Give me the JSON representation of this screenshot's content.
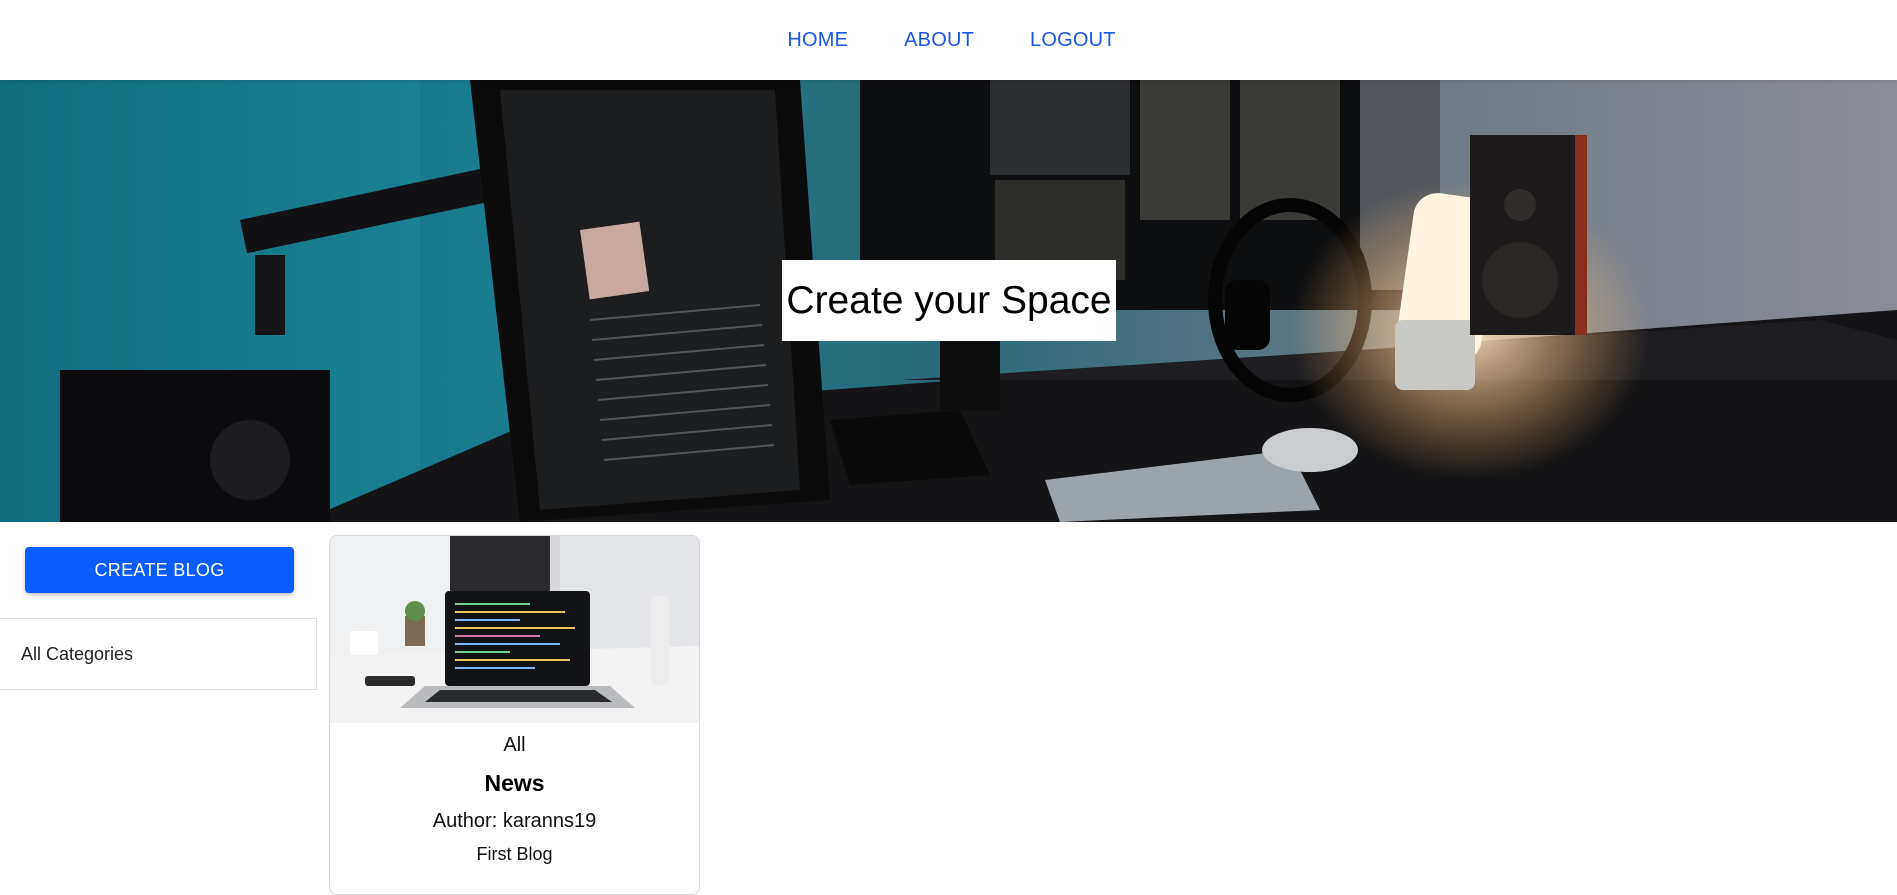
{
  "nav": {
    "items": [
      {
        "label": "HOME"
      },
      {
        "label": "ABOUT"
      },
      {
        "label": "LOGOUT"
      }
    ],
    "link_color": "#1a56e8"
  },
  "hero": {
    "title": "Create your Space",
    "image": "desk-setup-photo"
  },
  "sidebar": {
    "create_label": "CREATE BLOG",
    "create_color": "#0a5cff",
    "categories_label": "All Categories"
  },
  "posts": [
    {
      "image": "laptop-desk-photo",
      "category": "All",
      "title": "News",
      "author": "Author: karanns19",
      "description": "First Blog"
    }
  ]
}
